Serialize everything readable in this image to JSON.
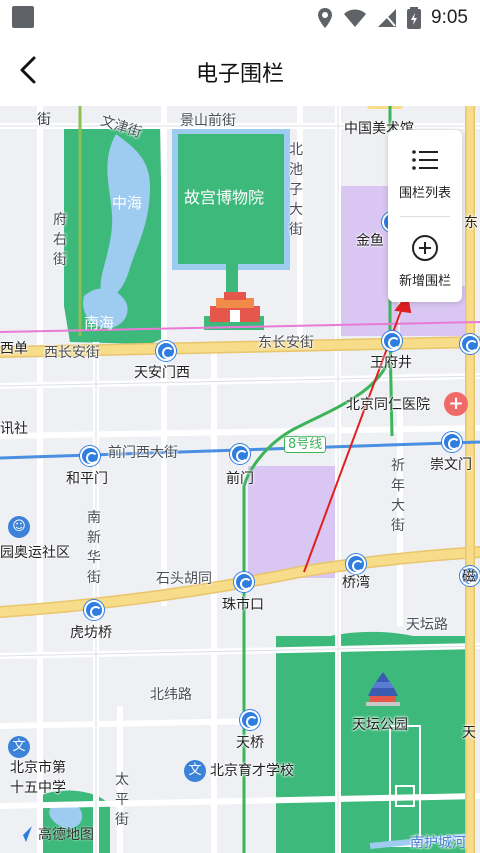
{
  "status_bar": {
    "time": "9:05"
  },
  "header": {
    "title": "电子围栏"
  },
  "panel": {
    "fence_list_label": "围栏列表",
    "add_fence_label": "新增围栏"
  },
  "map": {
    "attribution": "高德地图",
    "labels": {
      "wenjin": "文津街",
      "jingshan": "景山前街",
      "zhongguomei": "中国美术馆",
      "dong": "东",
      "jie_top": "街",
      "zhonghai": "中海",
      "gugong": "故宫博物院",
      "beichizi": "北池子大街",
      "fuyou": "府右街",
      "jinyu": "金鱼",
      "nanhai": "南海",
      "xidan": "西单",
      "xichangan": "西长安街",
      "dongchangan": "东长安街",
      "tiananmenxi": "天安门西",
      "wangfujing": "王府井",
      "tongren": "北京同仁医院",
      "xunshe": "讯社",
      "qianmenxi": "前门西大街",
      "line8": "8号线",
      "chongwen": "崇文门",
      "hepingmen": "和平门",
      "qianmen": "前门",
      "qinian": "祈年大街",
      "nanxinhua": "南新华街",
      "aoyun": "园奥运社区",
      "shitou": "石头胡同",
      "zhushikou": "珠市口",
      "qiaowan": "桥湾",
      "ci": "磁",
      "hufang": "虎坊桥",
      "tiantanlu": "天坛路",
      "beiwei": "北纬路",
      "tiantan": "天坛公园",
      "tiao": "天",
      "tianqiao": "天桥",
      "middle15": "北京市第十五中学",
      "yucai": "北京育才学校",
      "taiping": "太平街",
      "nanhucheng": "南护城河"
    }
  },
  "colors": {
    "accent_blue": "#2f7de1",
    "park_green": "#3cb97b",
    "road_yellow": "#f5d57a",
    "arrow_red": "#e02020"
  }
}
